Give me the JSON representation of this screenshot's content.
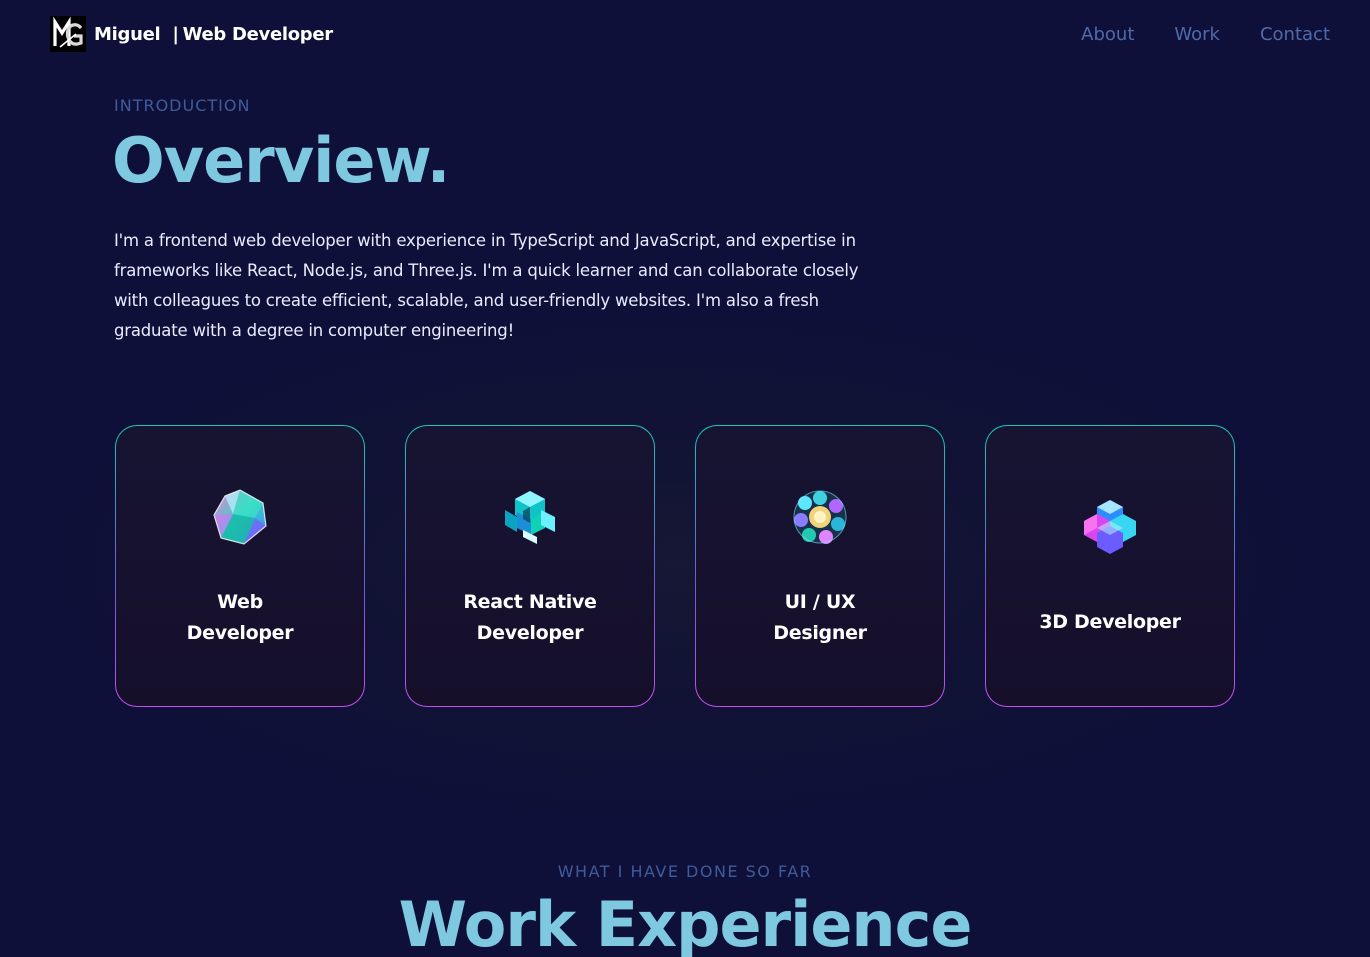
{
  "navbar": {
    "brand_name": "Miguel",
    "brand_separator": "|",
    "brand_role": "Web Developer",
    "logo_icon": "mg-monogram-logo",
    "links": [
      {
        "label": "About"
      },
      {
        "label": "Work"
      },
      {
        "label": "Contact"
      }
    ]
  },
  "overview": {
    "label": "INTRODUCTION",
    "title": "Overview.",
    "text": "I'm a frontend web developer with experience in TypeScript and JavaScript, and expertise in frameworks like React, Node.js, and Three.js. I'm a quick learner and can collaborate closely with colleagues to create efficient, scalable, and user-friendly websites. I'm also a fresh graduate with a degree in computer engineering!"
  },
  "services": [
    {
      "line1": "Web",
      "line2": "Developer",
      "icon": "icosahedron-icon"
    },
    {
      "line1": "React Native",
      "line2": "Developer",
      "icon": "cube-cluster-icon"
    },
    {
      "line1": "UI / UX",
      "line2": "Designer",
      "icon": "flower-sphere-icon"
    },
    {
      "line1": "3D Developer",
      "line2": "",
      "icon": "hexagon-cluster-icon"
    }
  ],
  "work": {
    "label": "WHAT I HAVE DONE SO FAR",
    "title": "Work Experience"
  },
  "colors": {
    "background": "#0f1039",
    "accent_title": "#7ec8e0",
    "nav_link": "#4f6aa8",
    "card_border_top": "#19c7b0",
    "card_border_bottom": "#c44ff0"
  }
}
